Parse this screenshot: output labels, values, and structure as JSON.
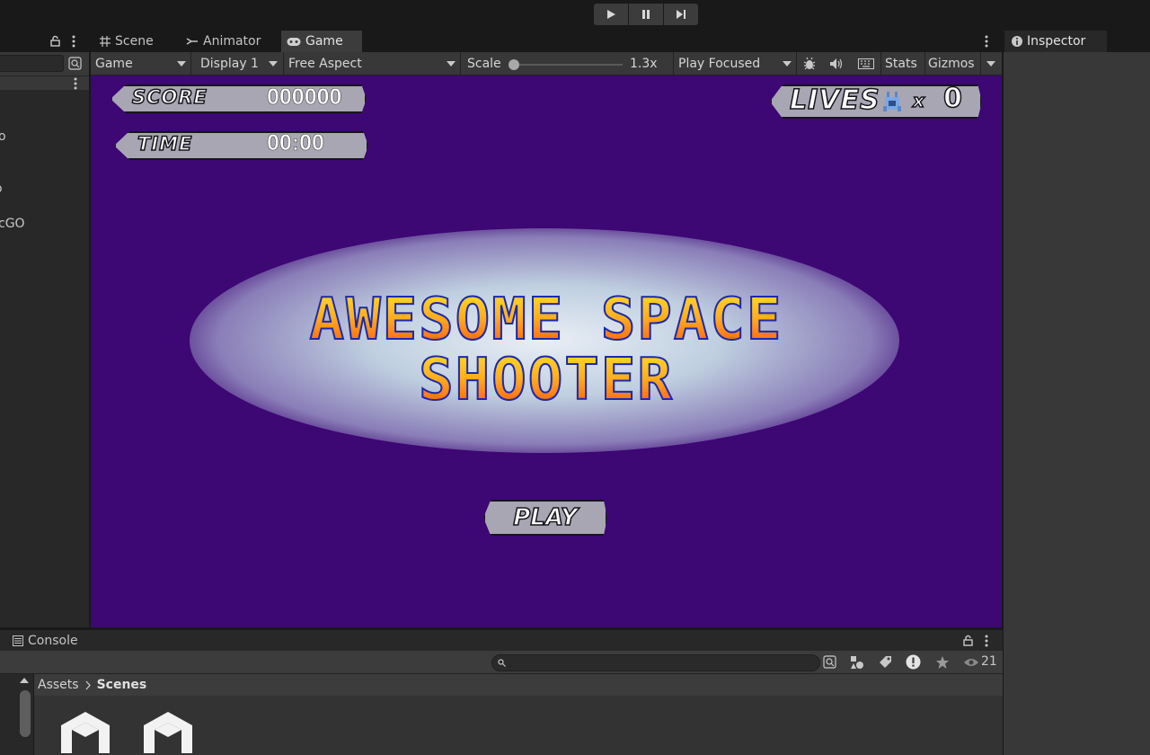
{
  "toolbar": {
    "play_icon": "play-icon",
    "pause_icon": "pause-icon",
    "step_icon": "step-icon"
  },
  "hierarchy": {
    "rows": [
      "o",
      "o",
      "cGO"
    ]
  },
  "game_tabs": [
    {
      "label": "Scene",
      "icon": "grid-icon"
    },
    {
      "label": "Animator",
      "icon": "animator-icon"
    },
    {
      "label": "Game",
      "icon": "gamepad-icon"
    }
  ],
  "game_bar": {
    "view": "Game",
    "display": "Display 1",
    "aspect": "Free Aspect",
    "scale_label": "Scale",
    "scale_value": "1.3x",
    "scale_level": 0.0,
    "play_mode": "Play Focused",
    "stats": "Stats",
    "gizmos": "Gizmos"
  },
  "game": {
    "score_label": "SCORE",
    "score_value": "000000",
    "time_label": "TIME",
    "time_value": "00:00",
    "lives_label": "LIVES",
    "lives_x": "x",
    "lives_value": "0",
    "title_line1": "AWESOME SPACE",
    "title_line2": "SHOOTER",
    "play_button": "PLAY"
  },
  "inspector": {
    "tab": "Inspector"
  },
  "console": {
    "tab": "Console",
    "count": "21"
  },
  "project": {
    "breadcrumb_root": "Assets",
    "breadcrumb_current": "Scenes"
  },
  "colors": {
    "viewport_bg": "#3d0774",
    "panel_bg": "#383838",
    "hud_plate": "#a9a6b3"
  }
}
